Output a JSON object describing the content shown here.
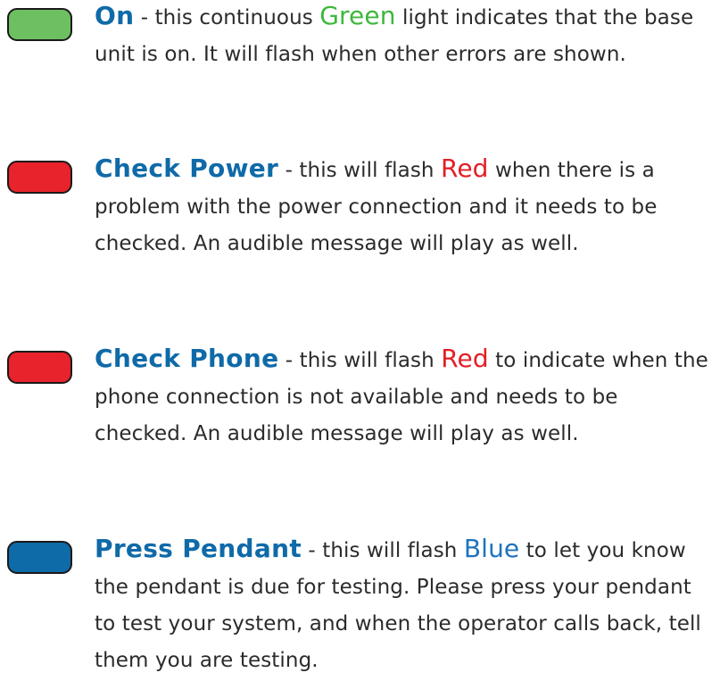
{
  "items": [
    {
      "title": "On",
      "before_color": " - this continuous ",
      "color_word": "Green",
      "after_color": " light indicates that the base unit is on. It will flash when other errors are shown.",
      "led_color": "#6dbf62",
      "word_color": "#3db83d"
    },
    {
      "title": "Check Power",
      "before_color": " - this will flash ",
      "color_word": "Red",
      "after_color": " when there is a problem with the power connection and it needs to be checked. An audible message will play as well.",
      "led_color": "#e8232b",
      "word_color": "#e31e26"
    },
    {
      "title": "Check Phone",
      "before_color": " - this will flash ",
      "color_word": "Red",
      "after_color": " to indicate when the phone connection is not available and needs to be checked. An audible message will play as well.",
      "led_color": "#e8232b",
      "word_color": "#e31e26"
    },
    {
      "title": "Press Pendant",
      "before_color": " - this will flash ",
      "color_word": "Blue",
      "after_color": " to let you know the pendant is due for testing. Please press your pendant to test your system, and when the operator calls back, tell them you are testing.",
      "led_color": "#0f6aa8",
      "word_color": "#1e73be"
    }
  ],
  "colors": {
    "title": "#0f6aa8",
    "body_text": "#2b2b2b"
  }
}
